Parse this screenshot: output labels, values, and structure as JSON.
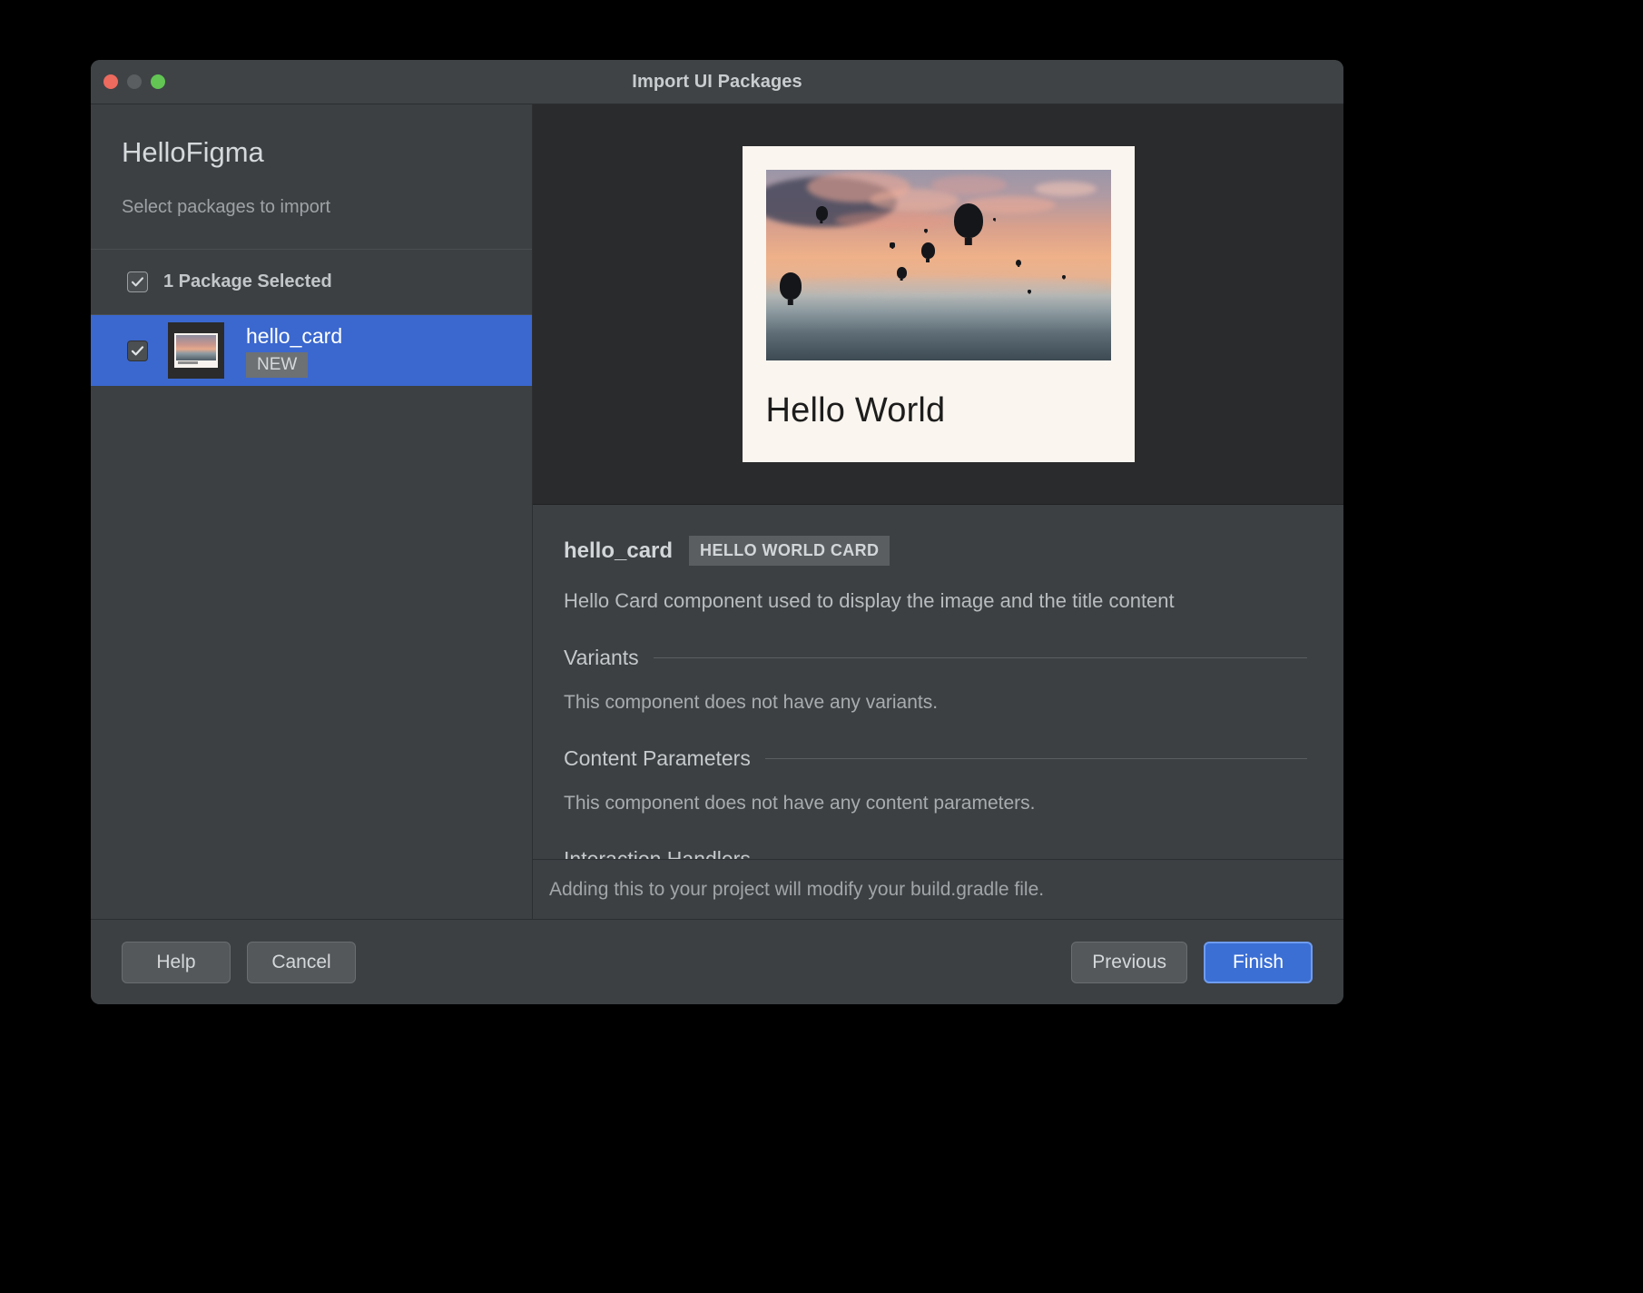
{
  "window": {
    "title": "Import UI Packages",
    "traffic_lights": [
      "close-button",
      "minimize-button",
      "zoom-button"
    ]
  },
  "sidebar": {
    "project_title": "HelloFigma",
    "subtitle": "Select packages to import",
    "select_all": {
      "label": "1 Package Selected",
      "checked": true
    },
    "packages": [
      {
        "name": "hello_card",
        "badge": "NEW",
        "checked": true,
        "selected": true,
        "thumbnail": "hello-card-thumbnail"
      }
    ]
  },
  "preview": {
    "card": {
      "image": "hot-air-balloons-sunset-photo",
      "title": "Hello World"
    }
  },
  "details": {
    "name": "hello_card",
    "tag": "HELLO WORLD CARD",
    "description": "Hello Card component used to display the image and the title content",
    "sections": [
      {
        "title": "Variants",
        "body": "This component does not have any variants."
      },
      {
        "title": "Content Parameters",
        "body": "This component does not have any content parameters."
      },
      {
        "title": "Interaction Handlers",
        "body": ""
      }
    ]
  },
  "footer_note": "Adding this to your project will modify your build.gradle file.",
  "buttons": {
    "help": "Help",
    "cancel": "Cancel",
    "previous": "Previous",
    "finish": "Finish"
  },
  "colors": {
    "window_bg": "#3c4043",
    "preview_bg": "#2a2b2c",
    "selection_blue": "#3b68cf",
    "primary_button": "#3b6fd4",
    "card_bg": "#faf5ef",
    "traffic_red": "#ed6a5e",
    "traffic_amber": "#5a5e61",
    "traffic_green": "#62c554"
  }
}
